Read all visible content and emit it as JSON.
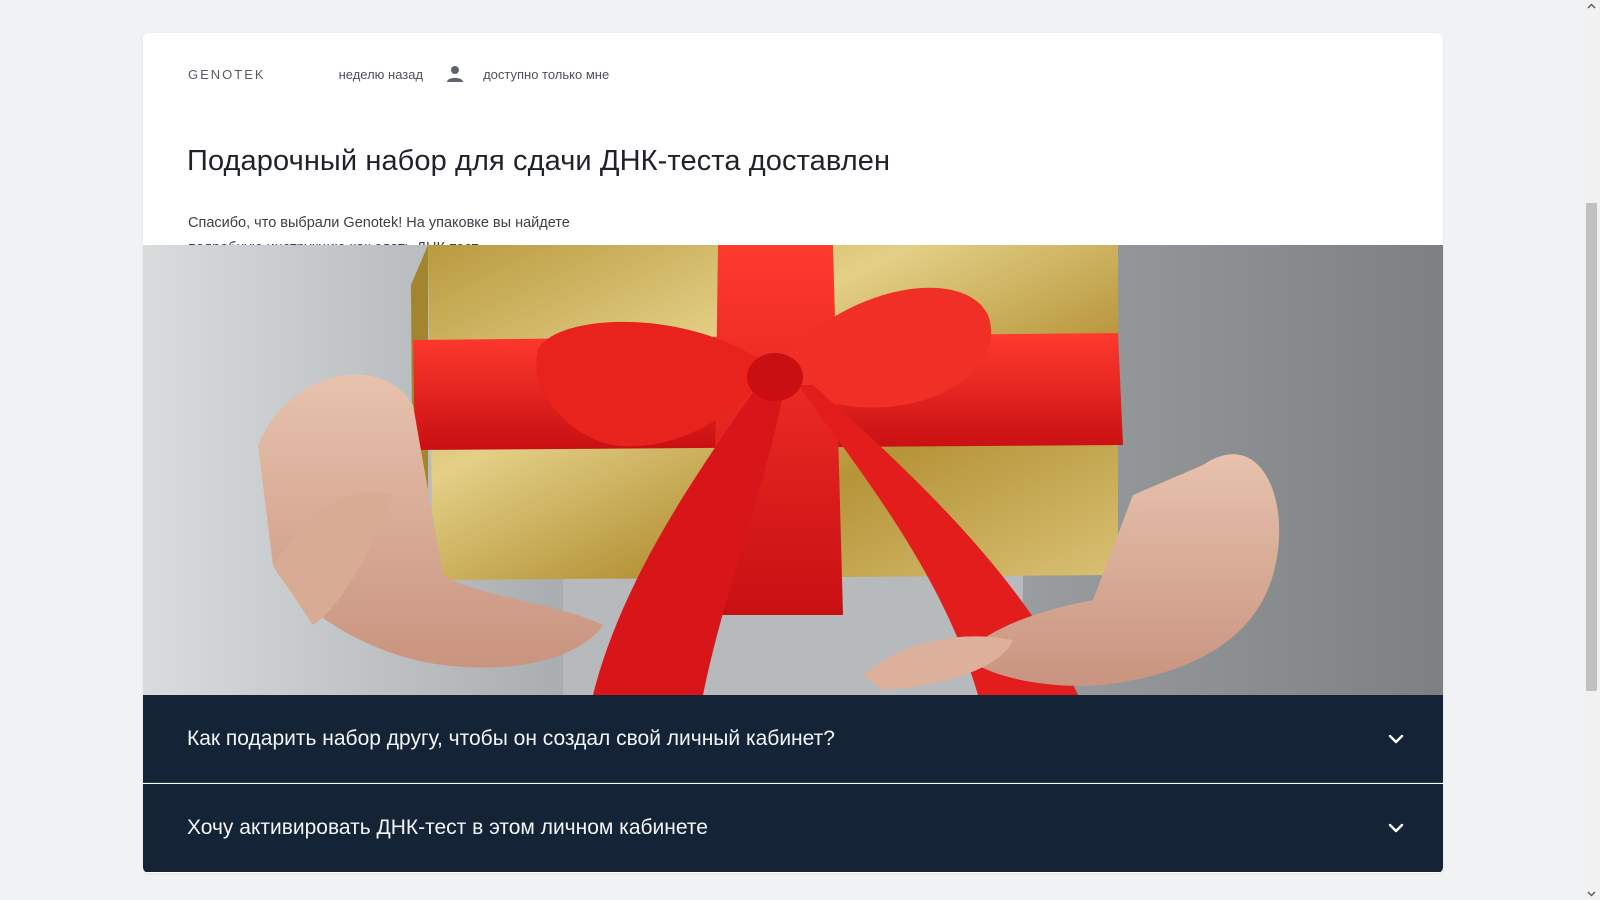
{
  "post": {
    "brand": "GENOTEK",
    "time": "неделю назад",
    "visibility": "доступно только мне",
    "title": "Подарочный набор для сдачи ДНК-теста доставлен",
    "description": "Спасибо, что выбрали Genotek! На упаковке вы найдете подробную инструкцию как сдать ДНК-тест.",
    "image_icon": "gift-box-photo"
  },
  "faq": [
    {
      "question": "Как подарить набор другу, чтобы он создал свой личный кабинет?",
      "icon": "chevron-down-icon"
    },
    {
      "question": "Хочу активировать ДНК-тест в этом личном кабинете",
      "icon": "chevron-down-icon"
    }
  ],
  "colors": {
    "page_bg": "#f1f2f4",
    "card_bg": "#ffffff",
    "faq_bg": "#152336",
    "ribbon": "#e01b1b",
    "gift_gold": "#c9a94c"
  }
}
